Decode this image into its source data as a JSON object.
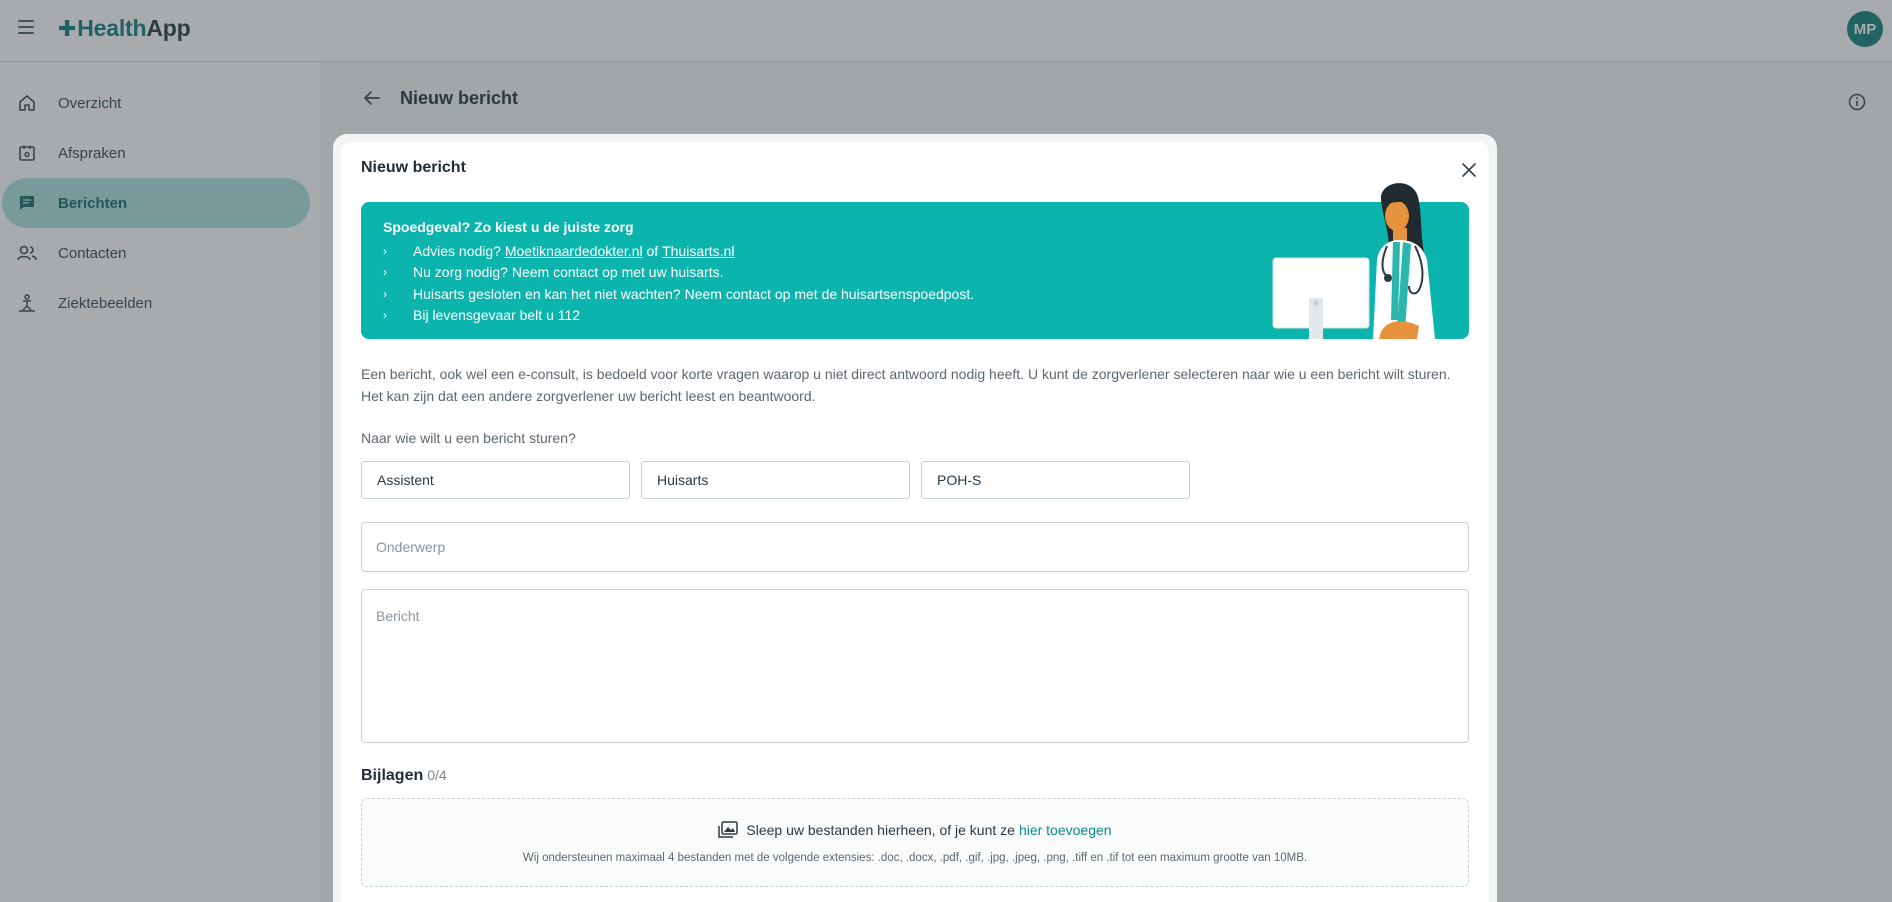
{
  "app": {
    "logo_main": "Health",
    "logo_accent": "App",
    "user_initials": "MP"
  },
  "colors": {
    "brand": "#0b7c78",
    "banner": "#0bb5ad",
    "active_nav": "#a9e1dd",
    "link": "#0b8b86"
  },
  "sidebar": {
    "items": [
      {
        "label": "Overzicht",
        "icon": "home-icon",
        "active": false
      },
      {
        "label": "Afspraken",
        "icon": "calendar-icon",
        "active": false
      },
      {
        "label": "Berichten",
        "icon": "message-icon",
        "active": true
      },
      {
        "label": "Contacten",
        "icon": "contacts-icon",
        "active": false
      },
      {
        "label": "Ziektebeelden",
        "icon": "conditions-icon",
        "active": false
      }
    ]
  },
  "page": {
    "title": "Nieuw bericht"
  },
  "modal": {
    "title": "Nieuw bericht",
    "banner": {
      "title": "Spoedgeval? Zo kiest u de juiste zorg",
      "line1_prefix": "Advies nodig?",
      "line1_link1": "Moetiknaardedokter.nl",
      "line1_mid": "of",
      "line1_link2": "Thuisarts.nl",
      "line2": "Nu zorg nodig? Neem contact op met uw huisarts.",
      "line3": "Huisarts gesloten en kan het niet wachten? Neem contact op met de huisartsenspoedpost.",
      "line4": "Bij levensgevaar belt u 112"
    },
    "intro": "Een bericht, ook wel een e-consult, is bedoeld voor korte vragen waarop u niet direct antwoord nodig heeft. U kunt de zorgverlener selecteren naar wie u een bericht wilt sturen. Het kan zijn dat een andere zorgverlener uw bericht leest en beantwoord.",
    "question": "Naar wie wilt u een bericht sturen?",
    "recipients": [
      "Assistent",
      "Huisarts",
      "POH-S"
    ],
    "subject": {
      "value": "",
      "placeholder": "Onderwerp"
    },
    "message": {
      "value": "",
      "placeholder": "Bericht"
    },
    "attachments": {
      "heading": "Bijlagen",
      "count": "0/4",
      "drop_text": "Sleep uw bestanden hierheen, of je kunt ze",
      "drop_link": "hier toevoegen",
      "info": "Wij ondersteunen maximaal 4 bestanden met de volgende extensies: .doc, .docx, .pdf, .gif, .jpg, .jpeg, .png, .tiff en .tif tot een maximum grootte van 10MB."
    }
  }
}
